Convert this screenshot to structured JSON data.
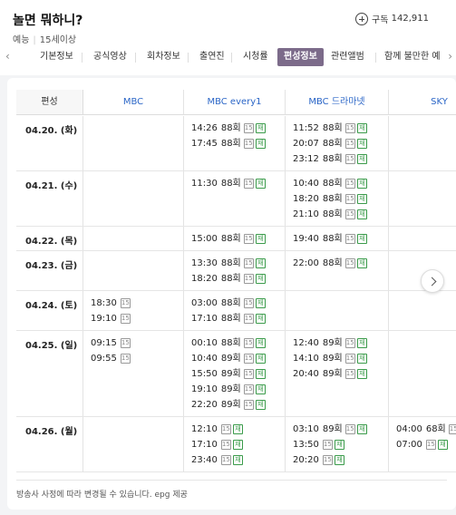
{
  "program": {
    "title": "놀면 뭐하니?",
    "genre": "예능",
    "rating": "15세이상",
    "subscribe_label": "구독",
    "subscribe_count": "142,911"
  },
  "tabs": [
    "기본정보",
    "공식영상",
    "회차정보",
    "출연진",
    "시청률",
    "편성정보",
    "관련앨범",
    "함께 불만한 예"
  ],
  "active_tab": "편성정보",
  "schedule": {
    "date_header": "편성",
    "channels": [
      "MBC",
      "MBC every1",
      "MBC 드라마넷",
      "SKY"
    ],
    "age_badge": "15",
    "rerun_badge": "재",
    "rows": [
      {
        "date": "04.20. (화)",
        "cells": [
          [],
          [
            {
              "time": "14:26",
              "ep": "88회",
              "re": true
            },
            {
              "time": "17:45",
              "ep": "88회",
              "re": true
            }
          ],
          [
            {
              "time": "11:52",
              "ep": "88회",
              "re": true
            },
            {
              "time": "20:07",
              "ep": "88회",
              "re": true
            },
            {
              "time": "23:12",
              "ep": "88회",
              "re": true
            }
          ],
          []
        ]
      },
      {
        "date": "04.21. (수)",
        "cells": [
          [],
          [
            {
              "time": "11:30",
              "ep": "88회",
              "re": true
            }
          ],
          [
            {
              "time": "10:40",
              "ep": "88회",
              "re": true
            },
            {
              "time": "18:20",
              "ep": "88회",
              "re": true
            },
            {
              "time": "21:10",
              "ep": "88회",
              "re": true
            }
          ],
          []
        ]
      },
      {
        "date": "04.22. (목)",
        "cells": [
          [],
          [
            {
              "time": "15:00",
              "ep": "88회",
              "re": true
            }
          ],
          [
            {
              "time": "19:40",
              "ep": "88회",
              "re": true
            }
          ],
          []
        ]
      },
      {
        "date": "04.23. (금)",
        "cells": [
          [],
          [
            {
              "time": "13:30",
              "ep": "88회",
              "re": true
            },
            {
              "time": "18:20",
              "ep": "88회",
              "re": true
            }
          ],
          [
            {
              "time": "22:00",
              "ep": "88회",
              "re": true
            }
          ],
          []
        ]
      },
      {
        "date": "04.24. (토)",
        "cells": [
          [
            {
              "time": "18:30",
              "ep": "",
              "re": false
            },
            {
              "time": "19:10",
              "ep": "",
              "re": false
            }
          ],
          [
            {
              "time": "03:00",
              "ep": "88회",
              "re": true
            },
            {
              "time": "17:10",
              "ep": "88회",
              "re": true
            }
          ],
          [],
          []
        ]
      },
      {
        "date": "04.25. (일)",
        "cells": [
          [
            {
              "time": "09:15",
              "ep": "",
              "re": false
            },
            {
              "time": "09:55",
              "ep": "",
              "re": false
            }
          ],
          [
            {
              "time": "00:10",
              "ep": "88회",
              "re": true
            },
            {
              "time": "10:40",
              "ep": "89회",
              "re": true
            },
            {
              "time": "15:50",
              "ep": "89회",
              "re": true
            },
            {
              "time": "19:10",
              "ep": "89회",
              "re": true
            },
            {
              "time": "22:20",
              "ep": "89회",
              "re": true
            }
          ],
          [
            {
              "time": "12:40",
              "ep": "89회",
              "re": true
            },
            {
              "time": "14:10",
              "ep": "89회",
              "re": true
            },
            {
              "time": "20:40",
              "ep": "89회",
              "re": true
            }
          ],
          []
        ]
      },
      {
        "date": "04.26. (월)",
        "cells": [
          [],
          [
            {
              "time": "12:10",
              "ep": "",
              "re": true
            },
            {
              "time": "17:10",
              "ep": "",
              "re": true
            },
            {
              "time": "23:40",
              "ep": "",
              "re": true
            }
          ],
          [
            {
              "time": "03:10",
              "ep": "89회",
              "re": true
            },
            {
              "time": "13:50",
              "ep": "",
              "re": true
            },
            {
              "time": "20:20",
              "ep": "",
              "re": true
            }
          ],
          [
            {
              "time": "04:00",
              "ep": "68회",
              "re": true
            },
            {
              "time": "07:00",
              "ep": "",
              "re": true
            }
          ]
        ]
      }
    ]
  },
  "note": "방송사 사정에 따라 변경될 수 있습니다. epg 제공",
  "colors": {
    "active_tab_bg": "#7c6b8a",
    "channel_text": "#2b66c7",
    "rerun_badge": "#3a9b4a"
  }
}
